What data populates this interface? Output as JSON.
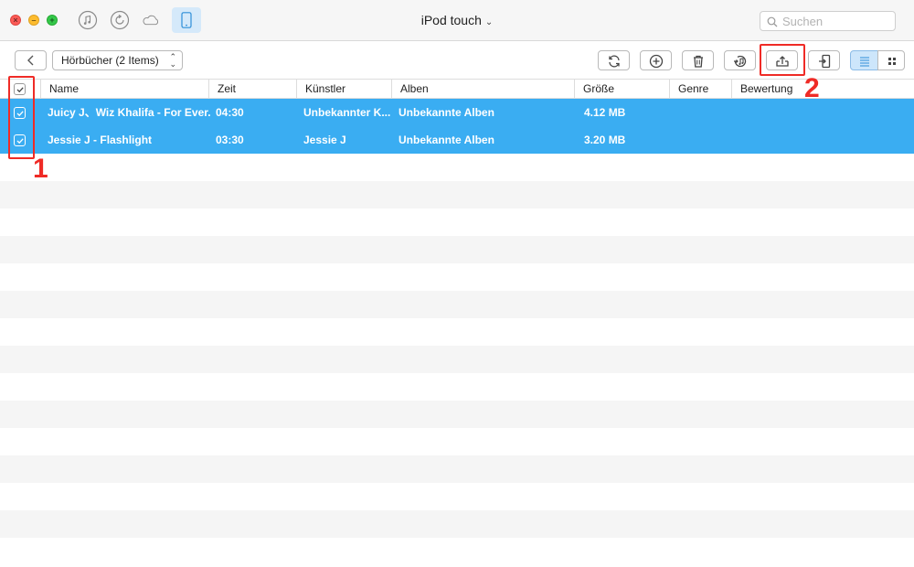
{
  "window": {
    "title": "iPod touch",
    "search_placeholder": "Suchen"
  },
  "nav_icons": [
    "music-icon",
    "backup-icon",
    "cloud-icon",
    "device-icon"
  ],
  "toolbar": {
    "category_label": "Hörbücher (2 Items)",
    "actions": [
      "refresh",
      "add",
      "delete",
      "to-itunes",
      "to-computer",
      "to-device"
    ],
    "active_view": "list"
  },
  "annotations": {
    "callout_1": "1",
    "callout_2": "2"
  },
  "table": {
    "columns": [
      "Name",
      "Zeit",
      "Künstler",
      "Alben",
      "Größe",
      "Genre",
      "Bewertung"
    ],
    "rows": [
      {
        "name": "Juicy J、Wiz Khalifa - For Ever...",
        "zeit": "04:30",
        "kuenstler": "Unbekannter K...",
        "alben": "Unbekannte Alben",
        "groesse": "4.12 MB",
        "genre": "",
        "bewertung": "",
        "selected": true
      },
      {
        "name": "Jessie J - Flashlight",
        "zeit": "03:30",
        "kuenstler": "Jessie J",
        "alben": "Unbekannte Alben",
        "groesse": "3.20 MB",
        "genre": "",
        "bewertung": "",
        "selected": true
      }
    ]
  },
  "colors": {
    "selection": "#3aadf2",
    "callout_red": "#ef2b26",
    "active_view_bg": "#cde6fb"
  }
}
